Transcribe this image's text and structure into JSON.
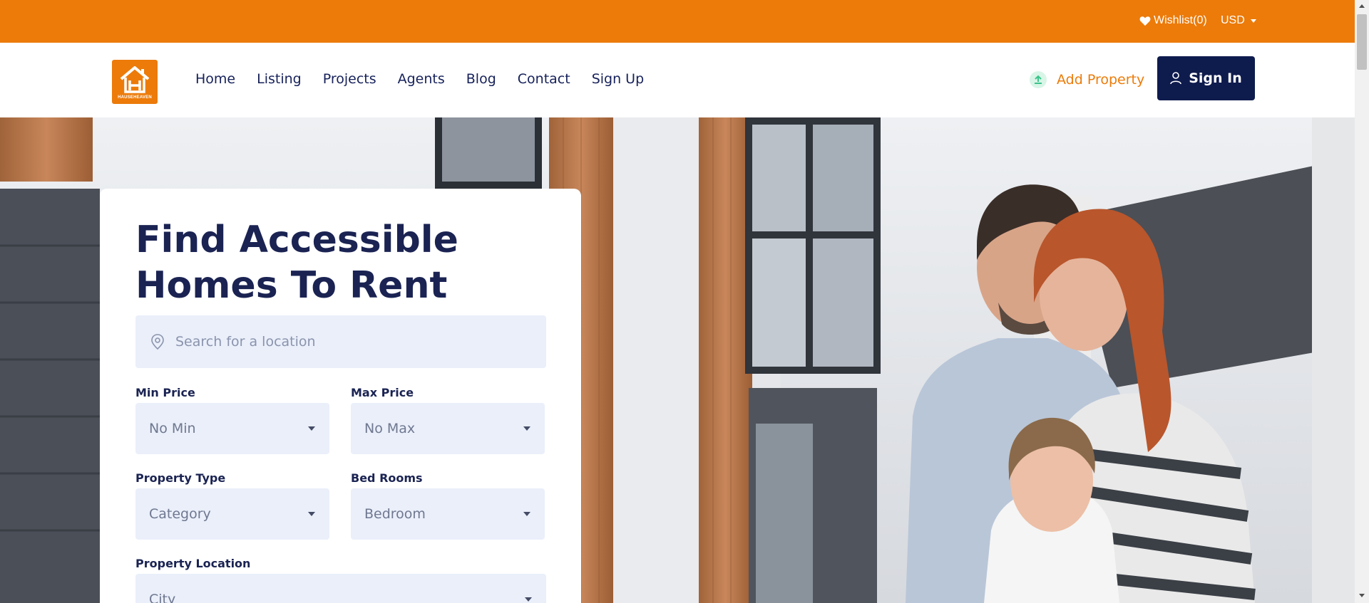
{
  "topbar": {
    "wishlist_label": "Wishlist(0)",
    "currency": "USD"
  },
  "header": {
    "logo_text": "HAUSEHEAVEN",
    "nav": [
      "Home",
      "Listing",
      "Projects",
      "Agents",
      "Blog",
      "Contact",
      "Sign Up"
    ],
    "add_property_label": "Add Property",
    "signin_label": "Sign In"
  },
  "search": {
    "title": "Find Accessible Homes To Rent",
    "location_placeholder": "Search for a location",
    "min_price": {
      "label": "Min Price",
      "value": "No Min"
    },
    "max_price": {
      "label": "Max Price",
      "value": "No Max"
    },
    "property_type": {
      "label": "Property Type",
      "value": "Category"
    },
    "bed_rooms": {
      "label": "Bed Rooms",
      "value": "Bedroom"
    },
    "property_location": {
      "label": "Property Location",
      "value": "City"
    }
  },
  "colors": {
    "brand_orange": "#ec7b0a",
    "navy": "#0e1b4d",
    "field_bg": "#eaeffa"
  },
  "hero": {
    "image": "family-in-front-of-modern-house-photo"
  }
}
